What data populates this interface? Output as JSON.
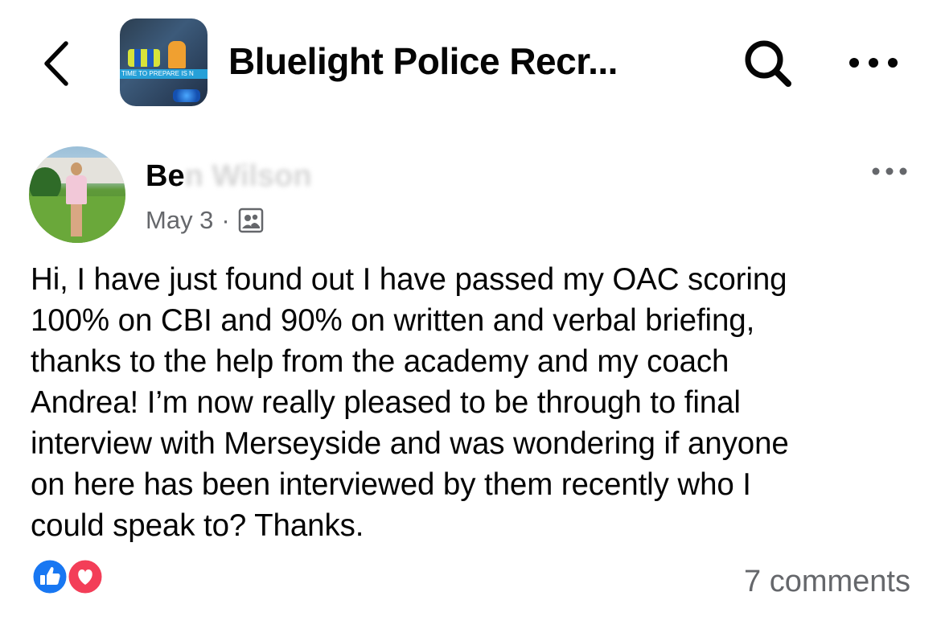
{
  "header": {
    "back_icon": "chevron-left-icon",
    "group_thumbnail_banner": "TIME TO PREPARE IS N",
    "group_title": "Bluelight Police Recr...",
    "search_icon": "search-icon",
    "more_icon": "more-horizontal-icon"
  },
  "post": {
    "author_name_visible": "Be",
    "author_name_obscured": "n Wilson",
    "date": "May 3",
    "separator": "·",
    "audience_icon": "group-members-icon",
    "more_icon": "more-horizontal-icon",
    "body": "Hi, I have just found out I have passed my OAC scoring\n100% on CBI and 90% on written and verbal briefing,\nthanks to the help from the academy and my coach\nAndrea! I’m now really pleased to be through to final\ninterview with Merseyside and was wondering if anyone\non here has been interviewed by them recently who I\ncould speak to? Thanks.",
    "reactions": [
      "like-reaction-icon",
      "love-reaction-icon"
    ],
    "comments_count": "7 comments"
  },
  "colors": {
    "text_primary": "#050505",
    "text_secondary": "#65676b",
    "like_blue": "#1877f2",
    "love_red": "#f33e58"
  }
}
